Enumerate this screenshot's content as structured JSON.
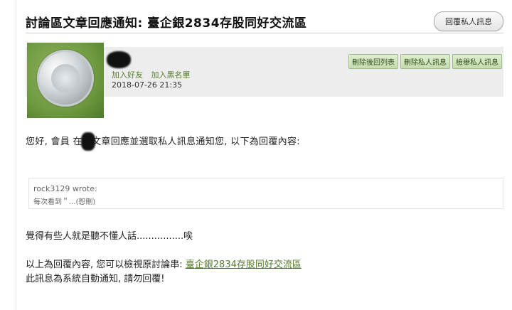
{
  "page": {
    "title": "討論區文章回應通知: 臺企銀2834存股同好交流區",
    "reply_button": "回覆私人訊息"
  },
  "header": {
    "links": [
      "加入好友",
      "加入黑名單"
    ],
    "date": "2018-07-26 21:35",
    "actions": [
      "刪除後回列表",
      "刪除私人訊息",
      "檢舉私人訊息"
    ]
  },
  "body": {
    "intro": "您好, 會員 在該文章回應並選取私人訊息通知您, 以下為回覆內容:",
    "quote_author": "rock3129 wrote:",
    "quote_text": "每次看到＂...(恕刪)",
    "reply": "覺得有些人就是聽不懂人話................唉",
    "footer_prefix": "以上為回覆內容, 您可以檢視原討論串: ",
    "footer_link": "臺企銀2834存股同好交流區",
    "notice": "此訊息為系統自動通知, 請勿回覆!"
  },
  "colors": {
    "link": "#557a2b",
    "action_bg": "#c7dcb1"
  }
}
